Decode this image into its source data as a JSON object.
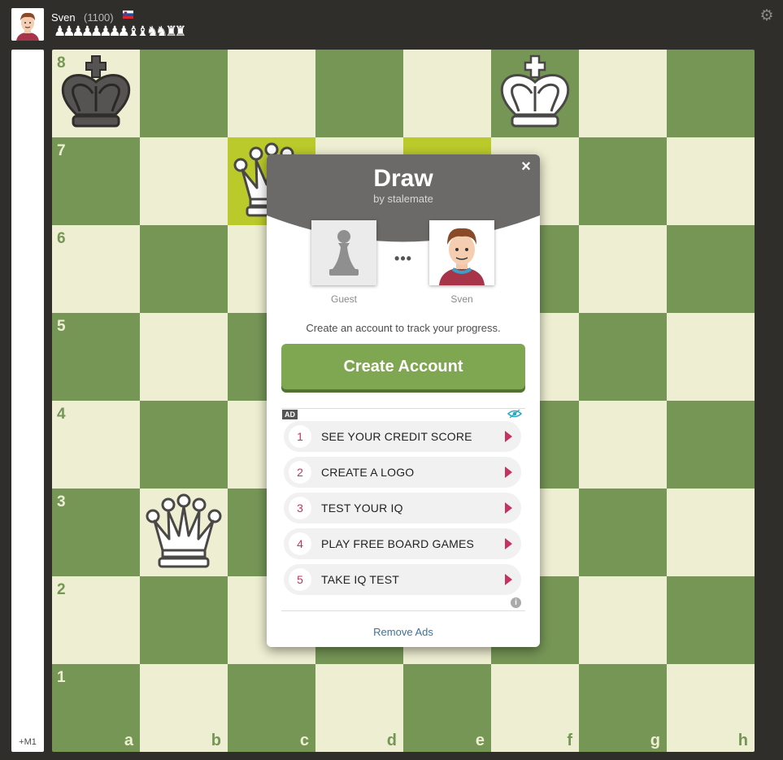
{
  "player": {
    "name": "Sven",
    "rating": "(1100)",
    "flag": "slovenia-flag",
    "captured": "♟♟♟♟♟♟♟♟ ♝♝ ♞♞ ♜♜"
  },
  "eval": {
    "text": "+M1"
  },
  "board": {
    "ranks": [
      "8",
      "7",
      "6",
      "5",
      "4",
      "3",
      "2",
      "1"
    ],
    "files": [
      "a",
      "b",
      "c",
      "d",
      "e",
      "f",
      "g",
      "h"
    ],
    "last_move": [
      "c7",
      "e7"
    ],
    "pieces": [
      {
        "square": "a8",
        "piece": "black-king"
      },
      {
        "square": "f8",
        "piece": "white-king"
      },
      {
        "square": "c7",
        "piece": "white-queen"
      },
      {
        "square": "b3",
        "piece": "white-queen"
      }
    ]
  },
  "colors": {
    "light": "#eeeed2",
    "dark": "#769656",
    "accent_green": "#7fa650",
    "ad_accent": "#c6335e",
    "modal_header": "#6b6a68"
  },
  "modal": {
    "title": "Draw",
    "subtitle": "by stalemate",
    "close": "×",
    "players": [
      {
        "name": "Guest",
        "avatar": "pawn-avatar"
      },
      {
        "name": "Sven",
        "avatar": "cartoon-man-avatar"
      }
    ],
    "vs": "•••",
    "message": "Create an account to track your progress.",
    "cta": "Create Account",
    "ad": {
      "badge": "AD",
      "items": [
        {
          "num": "1",
          "label": "SEE YOUR CREDIT SCORE"
        },
        {
          "num": "2",
          "label": "CREATE A LOGO"
        },
        {
          "num": "3",
          "label": "TEST YOUR IQ"
        },
        {
          "num": "4",
          "label": "PLAY FREE BOARD GAMES"
        },
        {
          "num": "5",
          "label": "TAKE IQ TEST"
        }
      ],
      "info": "i"
    },
    "remove_ads": "Remove Ads"
  }
}
